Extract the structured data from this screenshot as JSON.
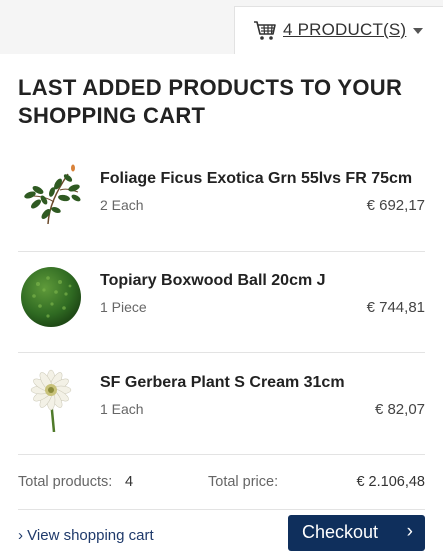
{
  "cart_tab": {
    "count_label": "4 PRODUCT(S)",
    "icon": "shopping-cart-icon"
  },
  "heading": "LAST ADDED PRODUCTS TO YOUR SHOPPING CART",
  "items": [
    {
      "name": "Foliage Ficus Exotica Grn 55lvs FR 75cm",
      "qty": "2 Each",
      "price": "€ 692,17",
      "image": "ficus-branch"
    },
    {
      "name": "Topiary Boxwood Ball 20cm J",
      "qty": "1 Piece",
      "price": "€ 744,81",
      "image": "boxwood-ball"
    },
    {
      "name": "SF Gerbera Plant S Cream 31cm",
      "qty": "1 Each",
      "price": "€ 82,07",
      "image": "gerbera-flower"
    }
  ],
  "totals": {
    "products_label": "Total products:",
    "products_value": "4",
    "price_label": "Total price:",
    "price_value": "€ 2.106,48"
  },
  "actions": {
    "view_cart_label": "› View shopping cart",
    "checkout_label": "Checkout",
    "checkout_chevron": "›"
  },
  "colors": {
    "primary": "#0f2f5c",
    "link": "#1f3a6b",
    "separator": "#e3e3e3"
  }
}
